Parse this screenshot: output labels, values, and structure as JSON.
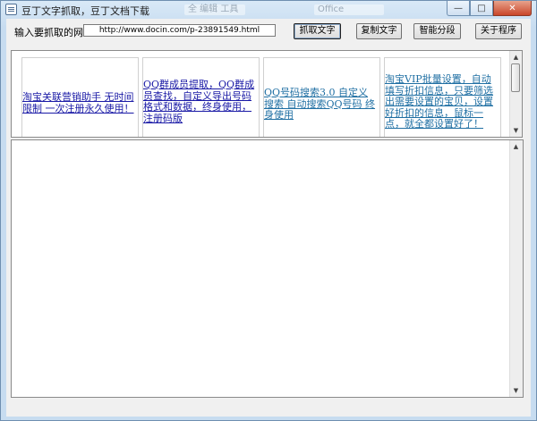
{
  "window": {
    "title": "豆丁文字抓取，豆丁文档下载",
    "ghost_tabs": [
      "全 编辑 工具",
      "Office"
    ],
    "controls": {
      "minimize": "—",
      "maximize": "□",
      "close": "✕"
    }
  },
  "toolbar": {
    "url_label": "输入要抓取的网址",
    "url_value": "http://www.docin.com/p-23891549.html",
    "fetch_label": "抓取文字",
    "copy_label": "复制文字",
    "split_label": "智能分段",
    "about_label": "关于程序"
  },
  "ads": [
    {
      "text": "淘宝关联营销助手 无时间限制 一次注册永久使用！"
    },
    {
      "text": "QQ群成员提取，QQ群成员查找，自定义导出号码格式和数据，终身使用，注册码版"
    },
    {
      "text": "QQ号码搜索3.0 自定义搜索 自动搜索QQ号码 终身使用"
    },
    {
      "text": "淘宝VIP批量设置，自动填写折扣信息，只要筛选出需要设置的宝贝，设置好折扣的信息，鼠标一点，就全都设置好了！"
    }
  ],
  "output": {
    "text": ""
  },
  "icons": {
    "scroll_up": "up-arrow-icon",
    "scroll_down": "down-arrow-icon",
    "app": "app-window-icon"
  }
}
